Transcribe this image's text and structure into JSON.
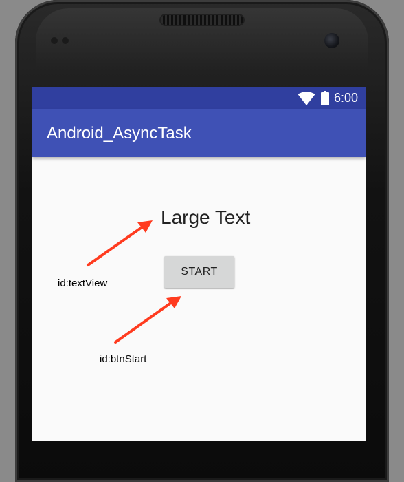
{
  "status_bar": {
    "time": "6:00",
    "icons": [
      "wifi-icon",
      "battery-icon"
    ],
    "color": "#303f9f"
  },
  "app_bar": {
    "title": "Android_AsyncTask",
    "color": "#3f51b5"
  },
  "content": {
    "large_text": "Large Text",
    "start_button_label": "START"
  },
  "annotations": {
    "text_view_id": "id:textView",
    "button_id": "id:btnStart",
    "arrow_color": "#ff3b1f"
  }
}
